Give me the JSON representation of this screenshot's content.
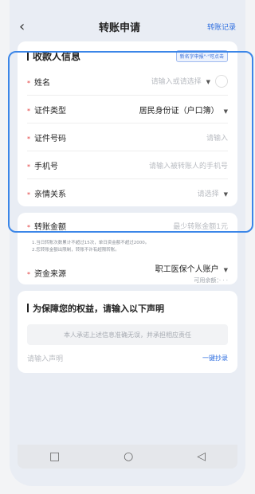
{
  "nav": {
    "title": "转账申请",
    "records": "转账记录"
  },
  "payee": {
    "section_title": "收款人信息",
    "badge": "新名字申报\"·\"可点击",
    "fields": [
      {
        "label": "姓名",
        "value": "请输入或请选择",
        "placeholder": true
      },
      {
        "label": "证件类型",
        "value": "居民身份证（户口簿）",
        "placeholder": false
      },
      {
        "label": "证件号码",
        "value": "请输入",
        "placeholder": true
      },
      {
        "label": "手机号",
        "value": "请输入被转账人的手机号",
        "placeholder": true
      },
      {
        "label": "亲情关系",
        "value": "请选择",
        "placeholder": true
      }
    ]
  },
  "transfer": {
    "amount_label": "转账金额",
    "amount_placeholder": "最少转账金额1元",
    "note1": "1.当日转账次数累计不超过15次，单日资金额不超过2000。",
    "note2": "2.您转账金额出限制，转账不许有超限转账。",
    "fund_label": "资金来源",
    "fund_value": "职工医保个人账户",
    "fund_balance_label": "可用余额：",
    "fund_balance_value": "· · ·"
  },
  "declaration": {
    "title": "为保障您的权益，请输入以下声明",
    "statement": "本人承诺上述信息准确无误，并承担相应责任",
    "input_placeholder": "请输入声明",
    "copy_label": "一键抄录"
  },
  "sysnav": {
    "back": "◁",
    "home": "○",
    "recents": "□"
  }
}
